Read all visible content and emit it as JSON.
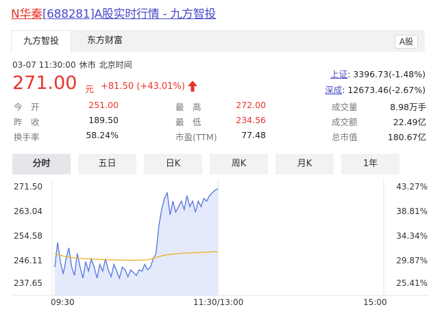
{
  "title": {
    "name": "N华秦",
    "rest": "[688281]A股实时行情 - 九方智投"
  },
  "source_tabs": [
    {
      "label": "九方智投",
      "active": true
    },
    {
      "label": "东方财富",
      "active": false
    }
  ],
  "market_badge": "A股",
  "meta": {
    "datetime": "03-07 11:30:00",
    "status": "休市",
    "tz": "北京时间"
  },
  "quote": {
    "price": "271.00",
    "unit": "元",
    "change": "+81.50",
    "change_pct": "(+43.01%)"
  },
  "indices": [
    {
      "name": "上证",
      "value": "3396.73(-1.48%)"
    },
    {
      "name": "深成",
      "value": "12673.46(-2.67%)"
    }
  ],
  "stats": [
    {
      "label": "今　开",
      "value": "251.00",
      "tone": "red"
    },
    {
      "label": "最　高",
      "value": "272.00",
      "tone": "red"
    },
    {
      "label": "成交量",
      "value": "8.98万手",
      "tone": "blk"
    },
    {
      "label": "昨　收",
      "value": "189.50",
      "tone": "blk"
    },
    {
      "label": "最　低",
      "value": "234.56",
      "tone": "red"
    },
    {
      "label": "成交额",
      "value": "22.49亿",
      "tone": "blk"
    },
    {
      "label": "换手率",
      "value": "58.24%",
      "tone": "blk"
    },
    {
      "label": "市盈(TTM)",
      "value": "77.48",
      "tone": "blk"
    },
    {
      "label": "总市值",
      "value": "180.67亿",
      "tone": "blk"
    }
  ],
  "period_tabs": [
    {
      "label": "分时",
      "active": true
    },
    {
      "label": "五日",
      "active": false
    },
    {
      "label": "日K",
      "active": false
    },
    {
      "label": "周K",
      "active": false
    },
    {
      "label": "月K",
      "active": false
    },
    {
      "label": "1年",
      "active": false
    }
  ],
  "colors": {
    "red": "#e8332a",
    "link": "#4a4acb",
    "price_line": "#5b7be0",
    "avg_line": "#f0b232",
    "area": "#dfe6fb"
  },
  "chart_data": {
    "type": "line",
    "y_ticks": [
      "271.50",
      "263.04",
      "254.58",
      "246.11",
      "237.65"
    ],
    "y_pct_ticks": [
      "43.27%",
      "38.81%",
      "34.34%",
      "29.87%",
      "25.41%"
    ],
    "x_ticks": [
      "09:30",
      "11:30/13:00",
      "15:00"
    ],
    "ylim": [
      237.65,
      271.5
    ],
    "series": [
      {
        "values": [
          242,
          251,
          244,
          239.5,
          245,
          249,
          242,
          239,
          247,
          242,
          238,
          244,
          240.5,
          245,
          242,
          238,
          243,
          240.5,
          245,
          241,
          238.5,
          243,
          240.5,
          238,
          242,
          241,
          238.5,
          241,
          240,
          239,
          241,
          240.5,
          243,
          241,
          242,
          245,
          247,
          257,
          263,
          267,
          269,
          261,
          266,
          262,
          264,
          266,
          263,
          268,
          264,
          266,
          262,
          266,
          264,
          267,
          266,
          268,
          269,
          270,
          270.5
        ]
      },
      {
        "values": [
          247.0,
          246.6,
          246.3,
          246.0,
          245.8,
          245.6,
          245.5,
          245.4,
          245.3,
          245.2,
          245.1,
          245.05,
          245.0,
          244.95,
          244.9,
          244.85,
          244.8,
          244.75,
          244.7,
          244.7,
          244.65,
          244.65,
          244.6,
          244.6,
          244.55,
          244.55,
          244.5,
          244.5,
          244.5,
          244.5,
          244.5,
          244.55,
          244.6,
          244.7,
          244.9,
          245.2,
          245.5,
          245.8,
          246.1,
          246.3,
          246.5,
          246.6,
          246.7,
          246.8,
          246.9,
          247.0,
          247.05,
          247.1,
          247.15,
          247.2,
          247.25,
          247.3,
          247.35,
          247.4,
          247.45,
          247.5,
          247.55,
          247.6,
          247.65
        ]
      }
    ]
  }
}
